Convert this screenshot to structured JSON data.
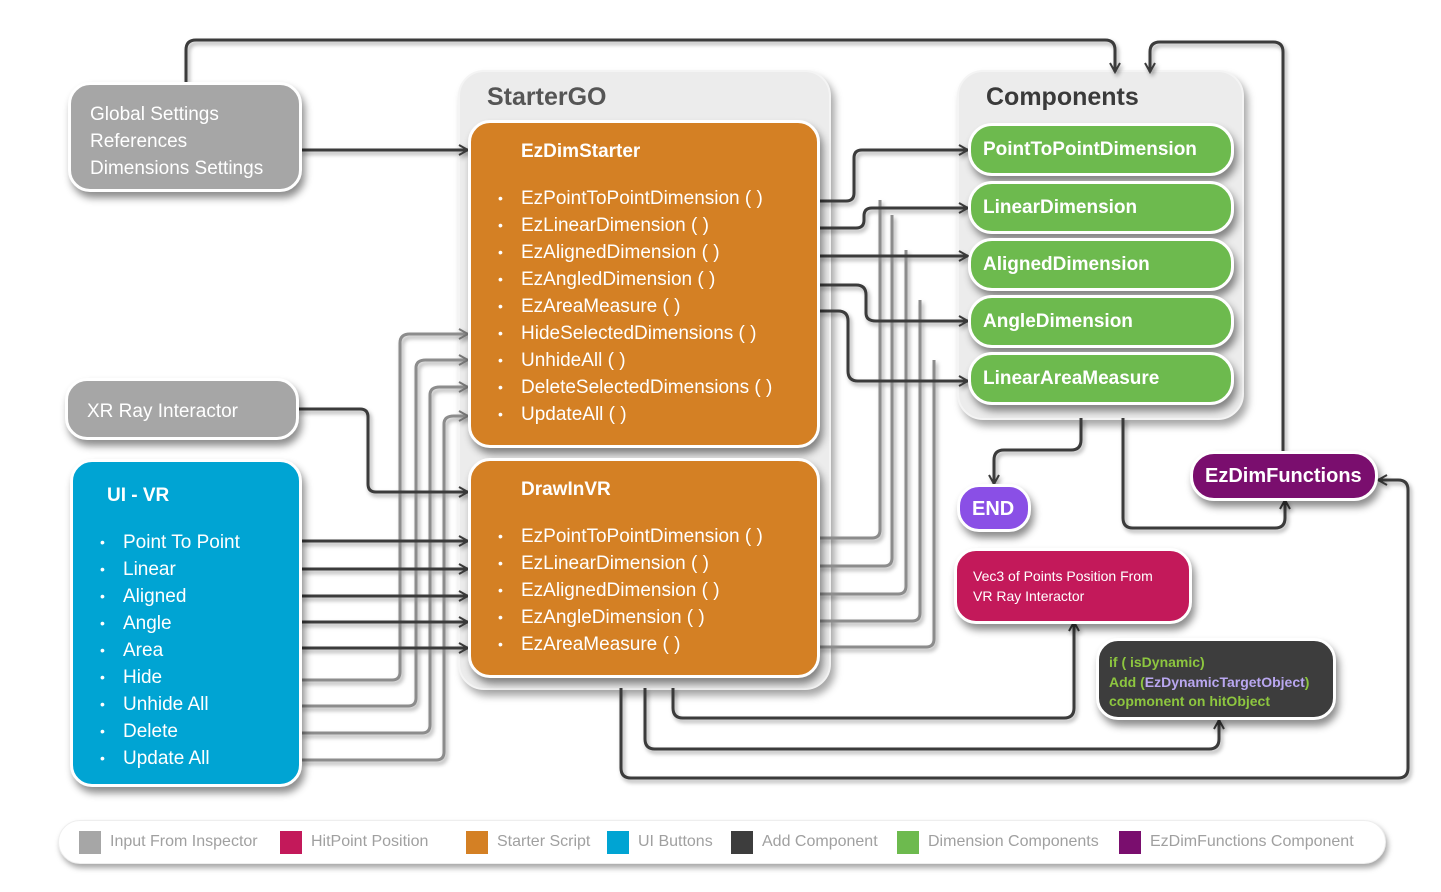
{
  "input_from_inspector": {
    "lines": [
      "Global Settings",
      "References",
      "Dimensions Settings"
    ]
  },
  "xr_ray_interactor": {
    "label": "XR Ray Interactor"
  },
  "ui_vr": {
    "title": "UI - VR",
    "items": [
      "Point To Point",
      "Linear",
      "Aligned",
      "Angle",
      "Area",
      "Hide",
      "Unhide All",
      "Delete",
      "Update All"
    ]
  },
  "starter_go": {
    "title": "StarterGO",
    "ez_dim_starter": {
      "title": "EzDimStarter",
      "methods": [
        "EzPointToPointDimension ( )",
        "EzLinearDimension ( )",
        "EzAlignedDimension ( )",
        "EzAngledDimension ( )",
        "EzAreaMeasure ( )",
        "HideSelectedDimensions ( )",
        "UnhideAll ( )",
        "DeleteSelectedDimensions ( )",
        "UpdateAll ( )"
      ]
    },
    "draw_in_vr": {
      "title": "DrawInVR",
      "methods": [
        "EzPointToPointDimension ( )",
        "EzLinearDimension ( )",
        "EzAlignedDimension ( )",
        "EzAngleDimension ( )",
        "EzAreaMeasure ( )"
      ]
    }
  },
  "components": {
    "title": "Components",
    "items": [
      "PointToPointDimension",
      "LinearDimension",
      "AlignedDimension",
      "AngleDimension",
      "LinearAreaMeasure"
    ]
  },
  "end_node": {
    "label": "END"
  },
  "ez_dim_functions": {
    "label": "EzDimFunctions"
  },
  "hitpoint": {
    "lines": [
      "Vec3 of Points Position From",
      "VR Ray Interactor"
    ]
  },
  "add_component": {
    "line1": "if ( isDynamic)",
    "line2_prefix": "Add (",
    "line2_highlight": "EzDynamicTargetObject",
    "line2_suffix": ")",
    "line3": "copmonent on hitObject"
  },
  "legend": [
    {
      "label": "Input From Inspector",
      "color": "#a6a6a6"
    },
    {
      "label": "HitPoint Position",
      "color": "#c3195a"
    },
    {
      "label": "Starter Script",
      "color": "#d48024"
    },
    {
      "label": "UI Buttons",
      "color": "#00a4d3"
    },
    {
      "label": "Add Component",
      "color": "#3d3d3d"
    },
    {
      "label": "Dimension Components",
      "color": "#6dba4e"
    },
    {
      "label": "EzDimFunctions Component",
      "color": "#7a0e6e"
    }
  ],
  "colors": {
    "input": "#a6a6a6",
    "starter": "#d48024",
    "ui": "#00a4d3",
    "components": "#6dba4e",
    "functions": "#7a0e6e",
    "end": "#8a4fe6",
    "hitpoint": "#c3195a",
    "add_component": "#3d3d3d",
    "code_green": "#8dc63f",
    "code_violet": "#b9a7f0"
  }
}
